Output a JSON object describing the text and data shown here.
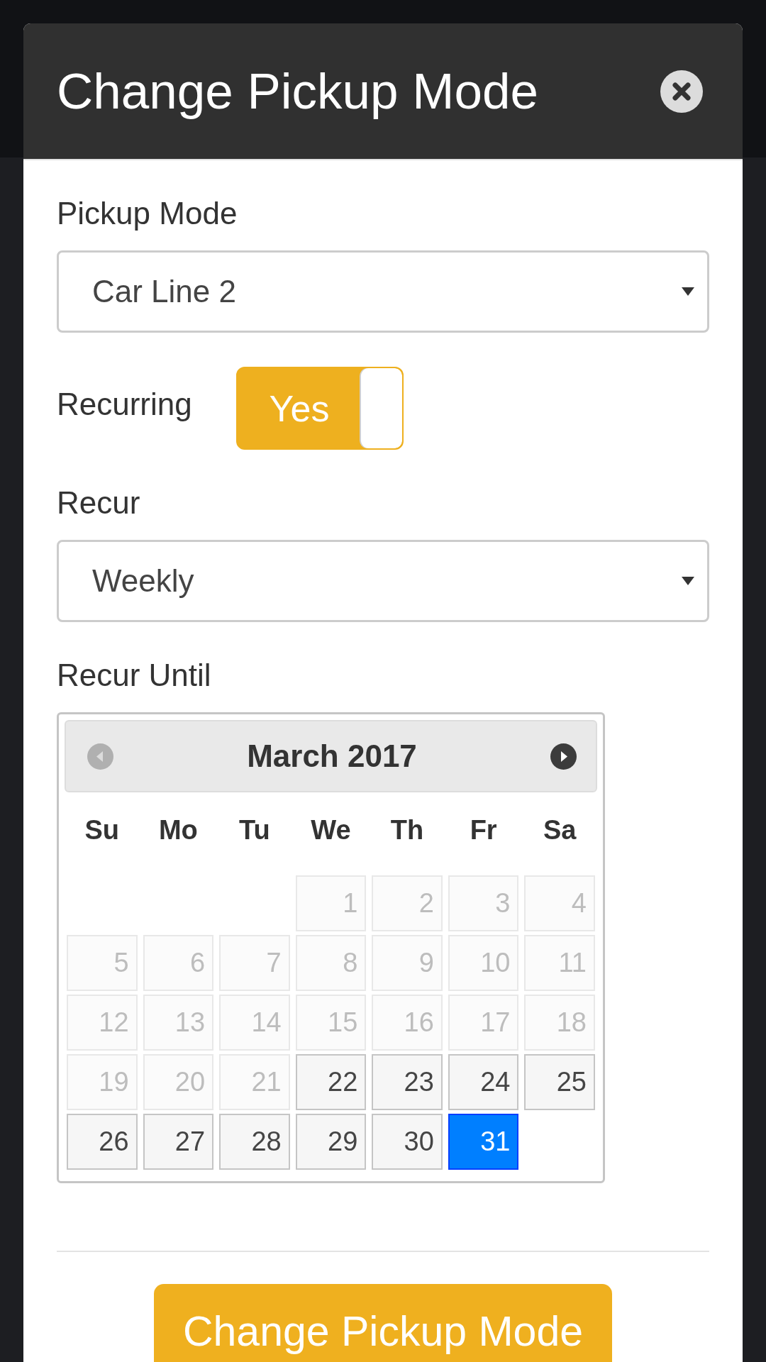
{
  "modal": {
    "title": "Change Pickup Mode"
  },
  "fields": [
    {
      "kind": "select",
      "label": "Pickup Mode",
      "value": "Car Line 2"
    },
    {
      "kind": "toggle",
      "label": "Recurring",
      "on": true,
      "text": "Yes"
    },
    {
      "kind": "select",
      "label": "Recur",
      "value": "Weekly"
    },
    {
      "kind": "calendar",
      "label": "Recur Until",
      "month": "March 2017",
      "prev": {
        "disabled": true
      },
      "next": {
        "disabled": false
      },
      "weekdays": [
        "Su",
        "Mo",
        "Tu",
        "We",
        "Th",
        "Fr",
        "Sa"
      ],
      "weeks": [
        [
          {
            "day": "1",
            "disabled": true,
            "selected": false
          },
          {
            "day": "2",
            "disabled": true,
            "selected": false
          },
          {
            "day": "3",
            "disabled": true,
            "selected": false
          },
          {
            "day": "4",
            "disabled": true,
            "selected": false
          }
        ],
        [
          {
            "day": "5",
            "disabled": true,
            "selected": false
          },
          {
            "day": "6",
            "disabled": true,
            "selected": false
          },
          {
            "day": "7",
            "disabled": true,
            "selected": false
          },
          {
            "day": "8",
            "disabled": true,
            "selected": false
          },
          {
            "day": "9",
            "disabled": true,
            "selected": false
          },
          {
            "day": "10",
            "disabled": true,
            "selected": false
          },
          {
            "day": "11",
            "disabled": true,
            "selected": false
          }
        ],
        [
          {
            "day": "12",
            "disabled": true,
            "selected": false
          },
          {
            "day": "13",
            "disabled": true,
            "selected": false
          },
          {
            "day": "14",
            "disabled": true,
            "selected": false
          },
          {
            "day": "15",
            "disabled": true,
            "selected": false
          },
          {
            "day": "16",
            "disabled": true,
            "selected": false
          },
          {
            "day": "17",
            "disabled": true,
            "selected": false
          },
          {
            "day": "18",
            "disabled": true,
            "selected": false
          }
        ],
        [
          {
            "day": "19",
            "disabled": true,
            "selected": false
          },
          {
            "day": "20",
            "disabled": true,
            "selected": false
          },
          {
            "day": "21",
            "disabled": true,
            "selected": false
          },
          {
            "day": "22",
            "disabled": false,
            "selected": false
          },
          {
            "day": "23",
            "disabled": false,
            "selected": false
          },
          {
            "day": "24",
            "disabled": false,
            "selected": false
          },
          {
            "day": "25",
            "disabled": false,
            "selected": false
          }
        ],
        [
          {
            "day": "26",
            "disabled": false,
            "selected": false
          },
          {
            "day": "27",
            "disabled": false,
            "selected": false
          },
          {
            "day": "28",
            "disabled": false,
            "selected": false
          },
          {
            "day": "29",
            "disabled": false,
            "selected": false
          },
          {
            "day": "30",
            "disabled": false,
            "selected": false
          },
          {
            "day": "31",
            "disabled": false,
            "selected": true
          }
        ]
      ]
    }
  ],
  "footer": {
    "button": "Change Pickup Mode"
  }
}
